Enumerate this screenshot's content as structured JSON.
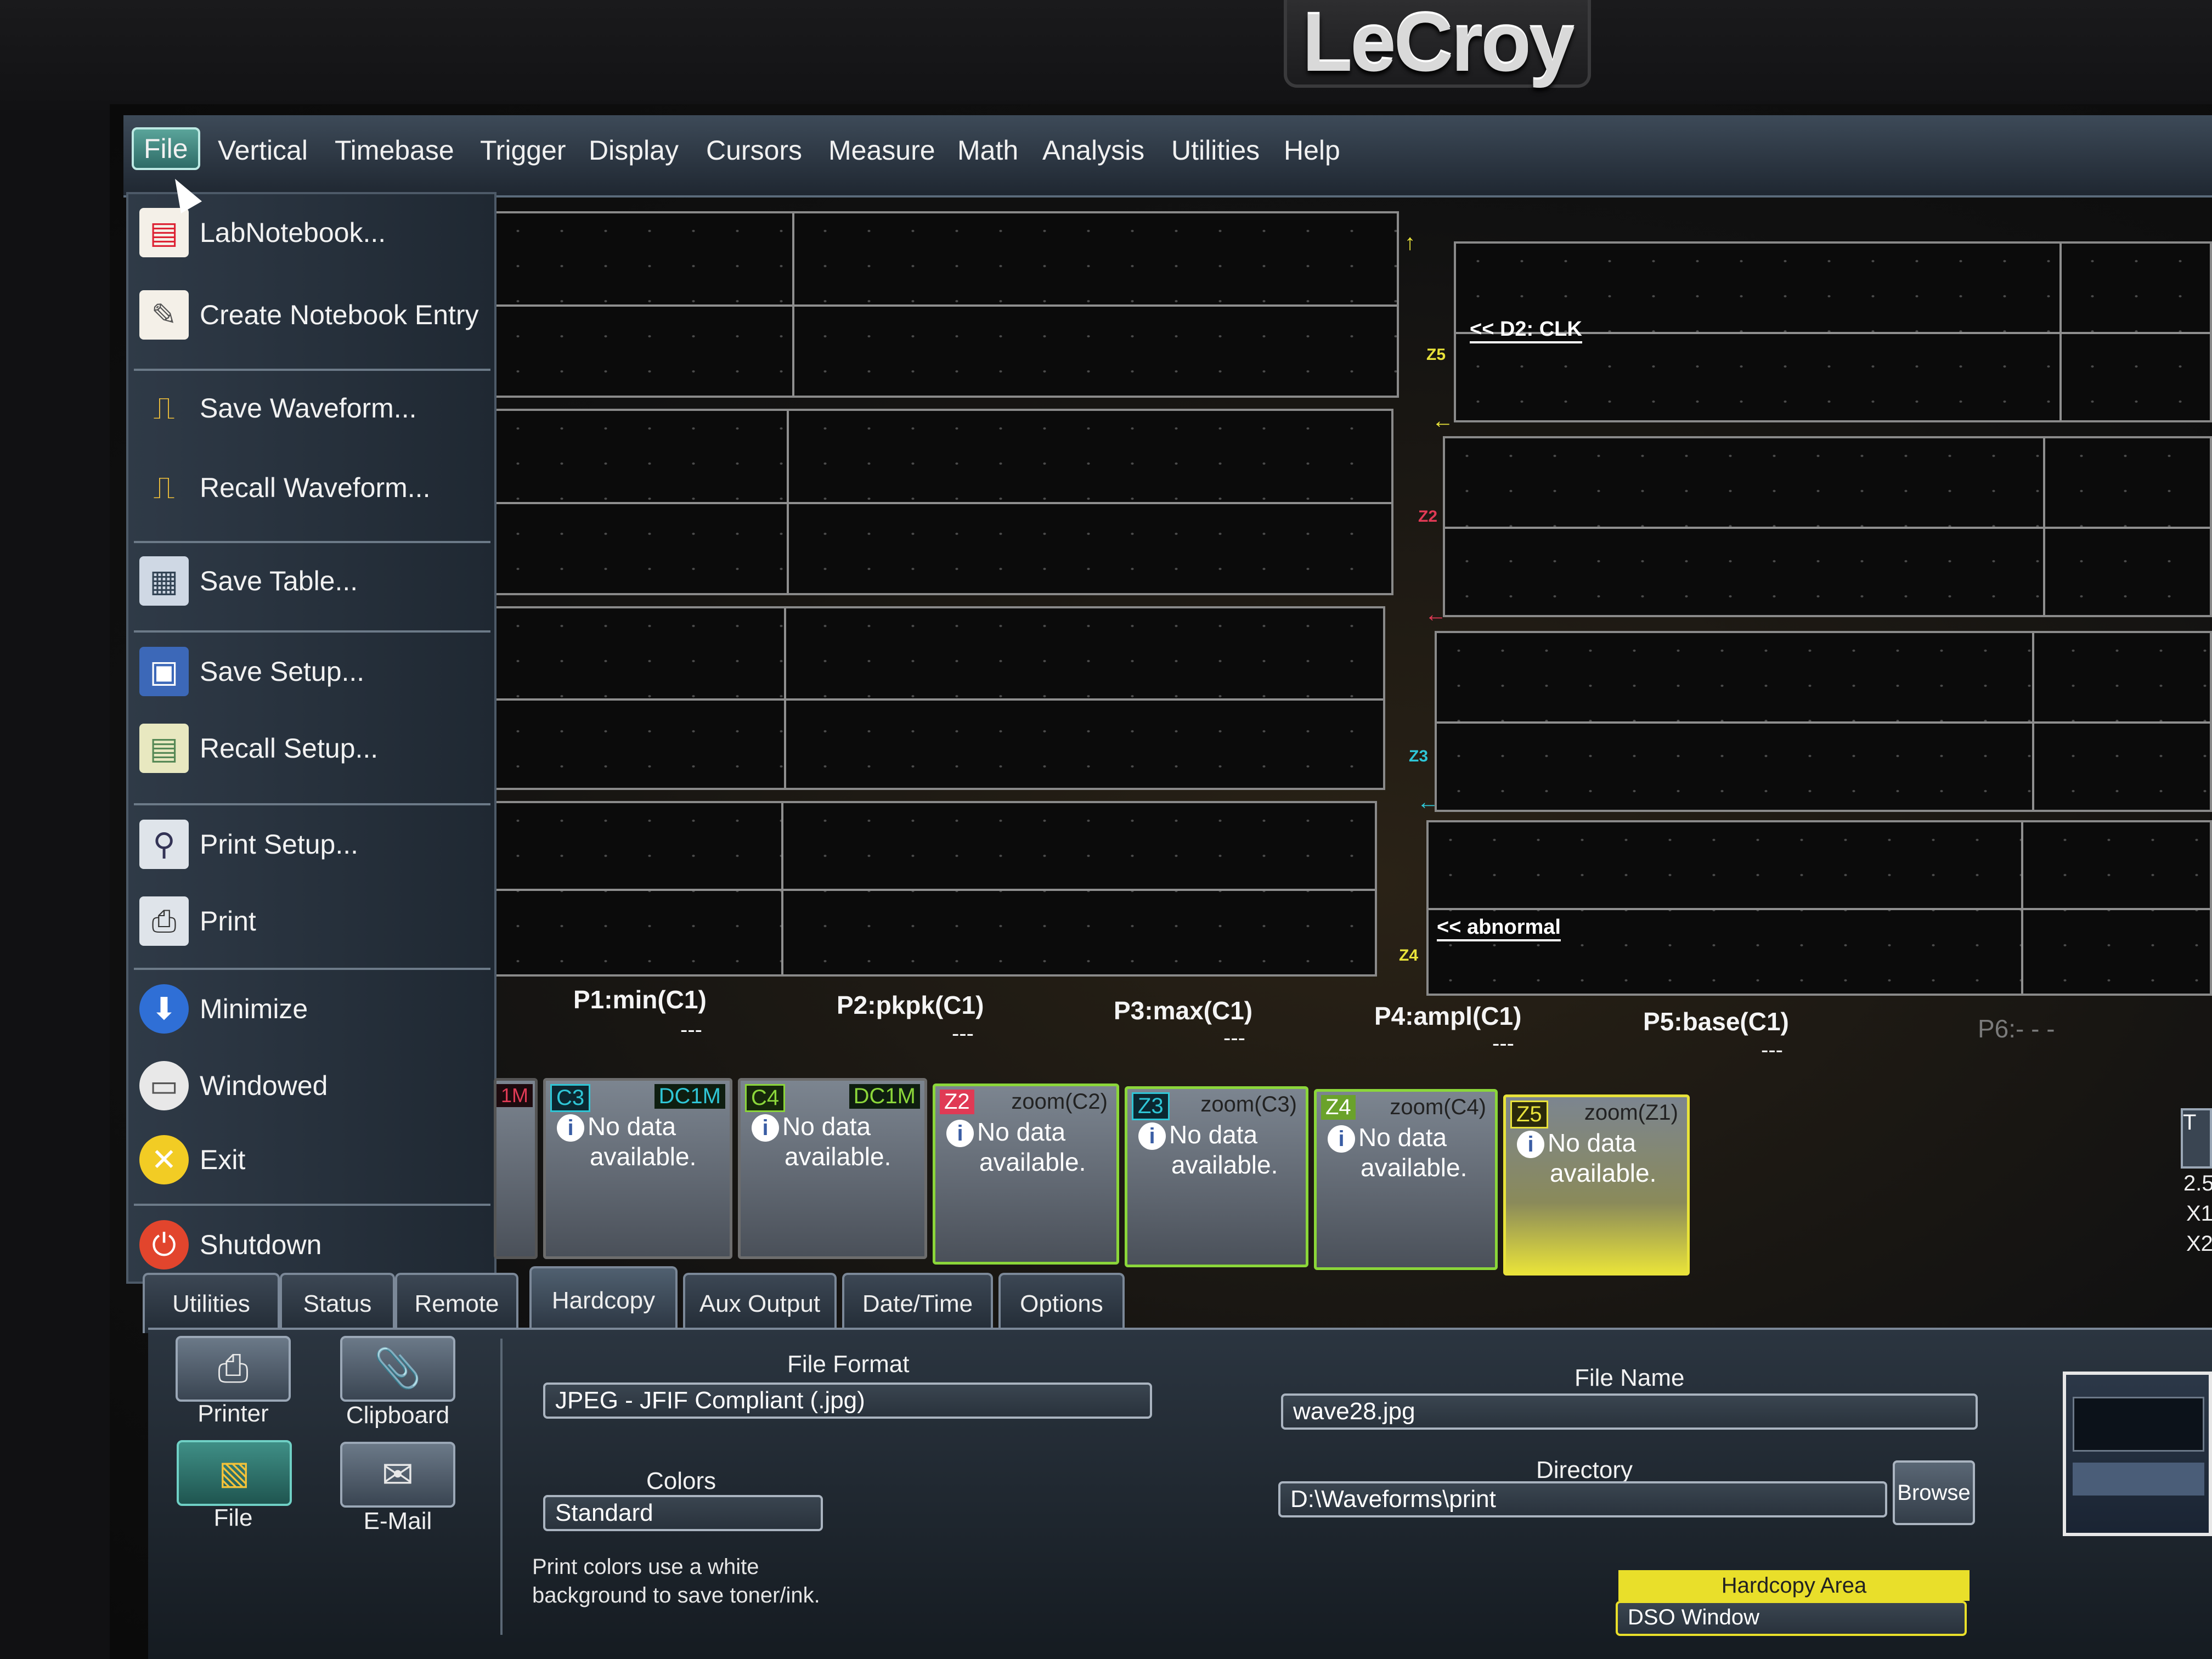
{
  "brand": "LeCroy",
  "colors": {
    "c3": "#2fc6d6",
    "c4": "#8bd63a",
    "z1_c1": "#e03a55",
    "z2": "#e03a55",
    "z3": "#2fc6d6",
    "z4": "#8bd63a",
    "z5": "#e8e23a",
    "accent": "#6fd0c5"
  },
  "menubar": {
    "items": [
      "File",
      "Vertical",
      "Timebase",
      "Trigger",
      "Display",
      "Cursors",
      "Measure",
      "Math",
      "Analysis",
      "Utilities",
      "Help"
    ]
  },
  "file_menu": {
    "items": [
      {
        "label": "LabNotebook...",
        "icon": "notebook-icon"
      },
      {
        "label": "Create Notebook Entry",
        "icon": "notebook-entry-icon"
      },
      {
        "label": "Save Waveform...",
        "icon": "save-waveform-icon"
      },
      {
        "label": "Recall Waveform...",
        "icon": "recall-waveform-icon"
      },
      {
        "label": "Save Table...",
        "icon": "save-table-icon"
      },
      {
        "label": "Save Setup...",
        "icon": "floppy-disk-icon"
      },
      {
        "label": "Recall Setup...",
        "icon": "recall-setup-icon"
      },
      {
        "label": "Print Setup...",
        "icon": "magnifier-icon"
      },
      {
        "label": "Print",
        "icon": "printer-icon"
      },
      {
        "label": "Minimize",
        "icon": "minimize-icon"
      },
      {
        "label": "Windowed",
        "icon": "window-icon"
      },
      {
        "label": "Exit",
        "icon": "exit-icon"
      },
      {
        "label": "Shutdown",
        "icon": "power-icon"
      }
    ]
  },
  "grids": {
    "labels": {
      "z5": "<< D2: CLK",
      "z4": "<< abnormal"
    },
    "zone_tags": [
      "Z5",
      "Z2",
      "Z3",
      "Z4"
    ]
  },
  "parameters": [
    {
      "label": "P1:min(C1)",
      "value": "---"
    },
    {
      "label": "P2:pkpk(C1)",
      "value": "---"
    },
    {
      "label": "P3:max(C1)",
      "value": "---"
    },
    {
      "label": "P4:ampl(C1)",
      "value": "---"
    },
    {
      "label": "P5:base(C1)",
      "value": "---"
    },
    {
      "label": "P6:- - -",
      "value": ""
    }
  ],
  "channels": [
    {
      "tag": "C3",
      "coupling": "DC1M",
      "msg1": "No data",
      "msg2": "available."
    },
    {
      "tag": "C4",
      "coupling": "DC1M",
      "msg1": "No data",
      "msg2": "available."
    },
    {
      "tag": "Z2",
      "coupling": "zoom(C2)",
      "msg1": "No data",
      "msg2": "available."
    },
    {
      "tag": "Z3",
      "coupling": "zoom(C3)",
      "msg1": "No data",
      "msg2": "available."
    },
    {
      "tag": "Z4",
      "coupling": "zoom(C4)",
      "msg1": "No data",
      "msg2": "available."
    },
    {
      "tag": "Z5",
      "coupling": "zoom(Z1)",
      "msg1": "No data",
      "msg2": "available."
    }
  ],
  "partial_channel_tag": "1M",
  "tabs": [
    "Utilities",
    "Status",
    "Remote",
    "Hardcopy",
    "Aux Output",
    "Date/Time",
    "Options"
  ],
  "hardcopy": {
    "destinations": [
      "Printer",
      "Clipboard",
      "File",
      "E-Mail"
    ],
    "file_format_label": "File Format",
    "file_format_value": "JPEG - JFIF Compliant (.jpg)",
    "colors_label": "Colors",
    "colors_value": "Standard",
    "note_line1": "Print colors use a white",
    "note_line2": "background to save toner/ink.",
    "file_name_label": "File Name",
    "file_name_value": "wave28.jpg",
    "directory_label": "Directory",
    "directory_value": "D:\\Waveforms\\print",
    "browse_label": "Browse",
    "area_label": "Hardcopy Area",
    "area_value": "DSO Window"
  },
  "right_edge": {
    "tag": "T",
    "line1": "2.5",
    "line2": "X1",
    "line3": "X2"
  }
}
